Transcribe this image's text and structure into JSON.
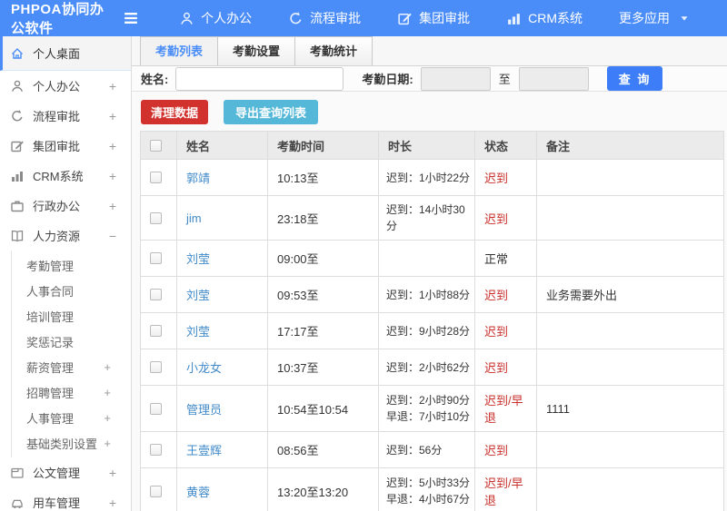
{
  "app": {
    "title": "PHPOA协同办公软件"
  },
  "topnav": {
    "items": [
      {
        "label": "个人办公",
        "icon": "user-icon"
      },
      {
        "label": "流程审批",
        "icon": "flow-icon"
      },
      {
        "label": "集团审批",
        "icon": "edit-icon"
      },
      {
        "label": "CRM系统",
        "icon": "chart-icon"
      },
      {
        "label": "更多应用",
        "icon": "caret-down-icon"
      }
    ]
  },
  "sidebar": {
    "items": [
      {
        "label": "个人桌面",
        "icon": "home-icon",
        "active": true
      },
      {
        "label": "个人办公",
        "icon": "user-icon",
        "toggle": "+"
      },
      {
        "label": "流程审批",
        "icon": "flow-icon",
        "toggle": "+"
      },
      {
        "label": "集团审批",
        "icon": "edit-icon",
        "toggle": "+"
      },
      {
        "label": "CRM系统",
        "icon": "chart-icon",
        "toggle": "+"
      },
      {
        "label": "行政办公",
        "icon": "briefcase-icon",
        "toggle": "+"
      },
      {
        "label": "人力资源",
        "icon": "book-icon",
        "toggle": "−",
        "expanded": true
      },
      {
        "label": "公文管理",
        "icon": "document-icon",
        "toggle": "+"
      },
      {
        "label": "用车管理",
        "icon": "car-icon",
        "toggle": "+"
      }
    ],
    "hr_subitems": [
      {
        "label": "考勤管理"
      },
      {
        "label": "人事合同"
      },
      {
        "label": "培训管理"
      },
      {
        "label": "奖惩记录"
      },
      {
        "label": "薪资管理",
        "toggle": "+"
      },
      {
        "label": "招聘管理",
        "toggle": "+"
      },
      {
        "label": "人事管理",
        "toggle": "+"
      },
      {
        "label": "基础类别设置",
        "toggle": "+"
      }
    ]
  },
  "tabs": [
    {
      "label": "考勤列表",
      "active": true
    },
    {
      "label": "考勤设置"
    },
    {
      "label": "考勤统计"
    }
  ],
  "filter": {
    "name_label": "姓名:",
    "date_label": "考勤日期:",
    "to_label": "至",
    "search_label": "查 询"
  },
  "actions": {
    "clean_label": "清理数据",
    "export_label": "导出查询列表"
  },
  "table": {
    "columns": [
      "姓名",
      "考勤时间",
      "时长",
      "状态",
      "备注"
    ],
    "rows": [
      {
        "name": "郭靖",
        "time": "10:13至",
        "duration": "迟到：1小时22分",
        "status": "迟到",
        "remark": ""
      },
      {
        "name": "jim",
        "time": "23:18至",
        "duration": "迟到：14小时30分",
        "status": "迟到",
        "remark": ""
      },
      {
        "name": "刘莹",
        "time": "09:00至",
        "duration": "",
        "status": "正常",
        "remark": ""
      },
      {
        "name": "刘莹",
        "time": "09:53至",
        "duration": "迟到：1小时88分",
        "status": "迟到",
        "remark": "业务需要外出"
      },
      {
        "name": "刘莹",
        "time": "17:17至",
        "duration": "迟到：9小时28分",
        "status": "迟到",
        "remark": ""
      },
      {
        "name": "小龙女",
        "time": "10:37至",
        "duration": "迟到：2小时62分",
        "status": "迟到",
        "remark": ""
      },
      {
        "name": "管理员",
        "time": "10:54至10:54",
        "duration": "迟到：2小时90分\n早退：7小时10分",
        "status": "迟到/早退",
        "remark": "1111"
      },
      {
        "name": "王壹辉",
        "time": "08:56至",
        "duration": "迟到：56分",
        "status": "迟到",
        "remark": ""
      },
      {
        "name": "黄蓉",
        "time": "13:20至13:20",
        "duration": "迟到：5小时33分\n早退：4小时67分",
        "status": "迟到/早退",
        "remark": ""
      }
    ]
  },
  "colors": {
    "topbar_blue": "#4b8df8",
    "accent_strip": "#4e97fb",
    "link_blue": "#428bca",
    "status_red": "#c9302c",
    "danger_button": "#d2322d",
    "info_button": "#56b8d9",
    "search_button": "#3d7ef8"
  }
}
